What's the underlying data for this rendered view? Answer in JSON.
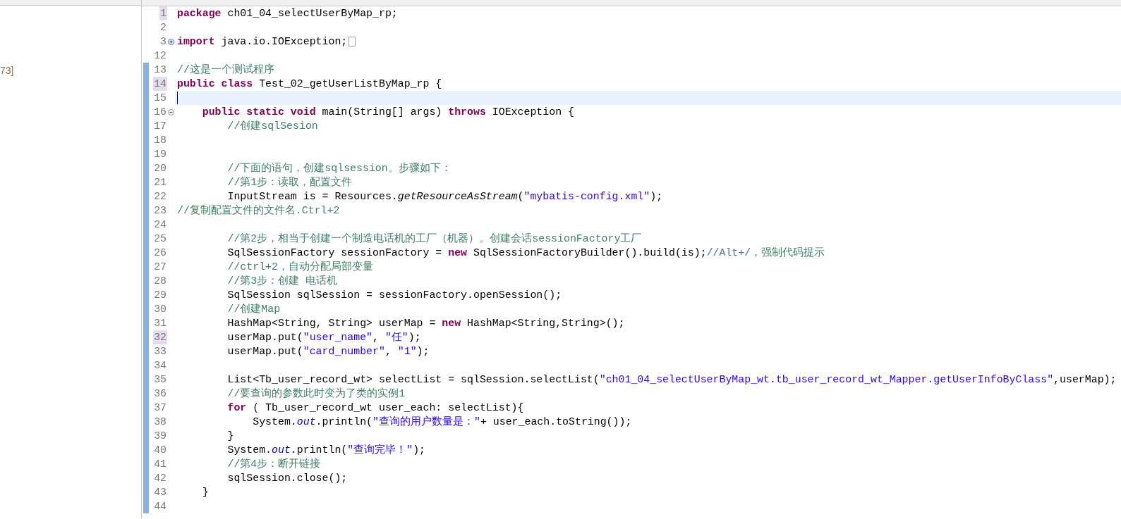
{
  "left_panel": {
    "text": "73]"
  },
  "editor": {
    "lines": [
      {
        "number": "1",
        "marked": true,
        "current": false,
        "changed": false,
        "tokens": [
          {
            "kind": "keyword",
            "text": "package"
          },
          {
            "kind": "plain",
            "text": " ch01_04_selectUserByMap_rp;"
          }
        ]
      },
      {
        "number": "2",
        "marked": false,
        "current": false,
        "changed": false
      },
      {
        "number": "3",
        "marked": false,
        "current": false,
        "changed": false,
        "folding": {
          "collapsed": true
        },
        "tokens": [
          {
            "kind": "keyword",
            "text": "import"
          },
          {
            "kind": "plain",
            "text": " java.io.IOException;"
          }
        ]
      },
      {
        "number": "12",
        "marked": false,
        "current": false,
        "changed": false
      },
      {
        "number": "13",
        "marked": false,
        "current": false,
        "changed": true,
        "tokens": [
          {
            "kind": "comment",
            "text": "//这是一个测试程序"
          }
        ]
      },
      {
        "number": "14",
        "marked": true,
        "current": false,
        "changed": true,
        "tokens": [
          {
            "kind": "keyword",
            "text": "public class"
          },
          {
            "kind": "plain",
            "text": " Test_02_getUserListByMap_rp {"
          }
        ]
      },
      {
        "number": "15",
        "marked": false,
        "current": true,
        "changed": true
      },
      {
        "number": "16",
        "marked": false,
        "current": false,
        "changed": true,
        "folding": {
          "collapsed": false
        },
        "tokens": [
          {
            "kind": "keyword",
            "text": "    public static void"
          },
          {
            "kind": "plain",
            "text": " main(String[] args) "
          },
          {
            "kind": "keyword",
            "text": "throws"
          },
          {
            "kind": "plain",
            "text": " IOException {"
          }
        ]
      },
      {
        "number": "17",
        "marked": false,
        "current": false,
        "changed": true,
        "tokens": [
          {
            "kind": "comment",
            "text": "        //创建sqlSesion"
          }
        ]
      },
      {
        "number": "18",
        "marked": false,
        "current": false,
        "changed": true
      },
      {
        "number": "19",
        "marked": false,
        "current": false,
        "changed": true
      },
      {
        "number": "20",
        "marked": false,
        "current": false,
        "changed": true,
        "tokens": [
          {
            "kind": "comment",
            "text": "        //下面的语句，创建sqlsession。步骤如下："
          }
        ]
      },
      {
        "number": "21",
        "marked": false,
        "current": false,
        "changed": true,
        "tokens": [
          {
            "kind": "comment",
            "text": "        //第1步：读取，配置文件"
          }
        ]
      },
      {
        "number": "22",
        "marked": false,
        "current": false,
        "changed": true,
        "tokens": [
          {
            "kind": "plain",
            "text": "        InputStream is = Resources."
          },
          {
            "kind": "static_method",
            "text": "getResourceAsStream"
          },
          {
            "kind": "plain",
            "text": "("
          },
          {
            "kind": "string",
            "text": "\"mybatis-config.xml\""
          },
          {
            "kind": "plain",
            "text": ");"
          }
        ]
      },
      {
        "number": "23",
        "marked": false,
        "current": false,
        "changed": true,
        "tokens": [
          {
            "kind": "comment",
            "text": "//复制配置文件的文件名.Ctrl+2"
          }
        ]
      },
      {
        "number": "24",
        "marked": false,
        "current": false,
        "changed": true
      },
      {
        "number": "25",
        "marked": false,
        "current": false,
        "changed": true,
        "tokens": [
          {
            "kind": "comment",
            "text": "        //第2步，相当于创建一个制造电话机的工厂（机器）。创建会话sessionFactory工厂"
          }
        ]
      },
      {
        "number": "26",
        "marked": false,
        "current": false,
        "changed": true,
        "tokens": [
          {
            "kind": "plain",
            "text": "        SqlSessionFactory sessionFactory = "
          },
          {
            "kind": "keyword",
            "text": "new"
          },
          {
            "kind": "plain",
            "text": " SqlSessionFactoryBuilder().build(is);"
          },
          {
            "kind": "comment",
            "text": "//Alt+/，强制代码提示"
          }
        ]
      },
      {
        "number": "27",
        "marked": false,
        "current": false,
        "changed": true,
        "tokens": [
          {
            "kind": "comment",
            "text": "        //ctrl+2，自动分配局部变量"
          }
        ]
      },
      {
        "number": "28",
        "marked": false,
        "current": false,
        "changed": true,
        "tokens": [
          {
            "kind": "comment",
            "text": "        //第3步：创建 电话机"
          }
        ]
      },
      {
        "number": "29",
        "marked": false,
        "current": false,
        "changed": true,
        "tokens": [
          {
            "kind": "plain",
            "text": "        SqlSession sqlSession = sessionFactory.openSession();"
          }
        ]
      },
      {
        "number": "30",
        "marked": false,
        "current": false,
        "changed": true,
        "tokens": [
          {
            "kind": "comment",
            "text": "        //创建Map"
          }
        ]
      },
      {
        "number": "31",
        "marked": false,
        "current": false,
        "changed": true,
        "tokens": [
          {
            "kind": "plain",
            "text": "        HashMap<String, String> userMap = "
          },
          {
            "kind": "keyword",
            "text": "new"
          },
          {
            "kind": "plain",
            "text": " HashMap<String,String>();"
          }
        ]
      },
      {
        "number": "32",
        "marked": true,
        "current": false,
        "changed": true,
        "tokens": [
          {
            "kind": "plain",
            "text": "        userMap.put("
          },
          {
            "kind": "string",
            "text": "\"user_name\""
          },
          {
            "kind": "plain",
            "text": ", "
          },
          {
            "kind": "string",
            "text": "\"任\""
          },
          {
            "kind": "plain",
            "text": ");"
          }
        ]
      },
      {
        "number": "33",
        "marked": false,
        "current": false,
        "changed": true,
        "tokens": [
          {
            "kind": "plain",
            "text": "        userMap.put("
          },
          {
            "kind": "string",
            "text": "\"card_number\""
          },
          {
            "kind": "plain",
            "text": ", "
          },
          {
            "kind": "string",
            "text": "\"1\""
          },
          {
            "kind": "plain",
            "text": ");"
          }
        ]
      },
      {
        "number": "34",
        "marked": false,
        "current": false,
        "changed": true
      },
      {
        "number": "35",
        "marked": false,
        "current": false,
        "changed": true,
        "tokens": [
          {
            "kind": "plain",
            "text": "        List<Tb_user_record_wt> selectList = sqlSession.selectList("
          },
          {
            "kind": "string",
            "text": "\"ch01_04_selectUserByMap_wt.tb_user_record_wt_Mapper.getUserInfoByClass\""
          },
          {
            "kind": "plain",
            "text": ",userMap);"
          }
        ]
      },
      {
        "number": "36",
        "marked": false,
        "current": false,
        "changed": true,
        "tokens": [
          {
            "kind": "comment",
            "text": "        //要查询的参数此时变为了类的实例1"
          }
        ]
      },
      {
        "number": "37",
        "marked": false,
        "current": false,
        "changed": true,
        "tokens": [
          {
            "kind": "keyword",
            "text": "        for"
          },
          {
            "kind": "plain",
            "text": " ( Tb_user_record_wt user_each: selectList){"
          }
        ]
      },
      {
        "number": "38",
        "marked": false,
        "current": false,
        "changed": true,
        "tokens": [
          {
            "kind": "plain",
            "text": "            System."
          },
          {
            "kind": "static_field",
            "text": "out"
          },
          {
            "kind": "plain",
            "text": ".println("
          },
          {
            "kind": "string",
            "text": "\"查询的用户数量是：\""
          },
          {
            "kind": "plain",
            "text": "+ user_each.toString());"
          }
        ]
      },
      {
        "number": "39",
        "marked": false,
        "current": false,
        "changed": true,
        "tokens": [
          {
            "kind": "plain",
            "text": "        }"
          }
        ]
      },
      {
        "number": "40",
        "marked": false,
        "current": false,
        "changed": true,
        "tokens": [
          {
            "kind": "plain",
            "text": "        System."
          },
          {
            "kind": "static_field",
            "text": "out"
          },
          {
            "kind": "plain",
            "text": ".println("
          },
          {
            "kind": "string",
            "text": "\"查询完毕！\""
          },
          {
            "kind": "plain",
            "text": ");"
          }
        ]
      },
      {
        "number": "41",
        "marked": false,
        "current": false,
        "changed": true,
        "tokens": [
          {
            "kind": "comment",
            "text": "        //第4步：断开链接"
          }
        ]
      },
      {
        "number": "42",
        "marked": false,
        "current": false,
        "changed": true,
        "tokens": [
          {
            "kind": "plain",
            "text": "        sqlSession.close();"
          }
        ]
      },
      {
        "number": "43",
        "marked": false,
        "current": false,
        "changed": true,
        "tokens": [
          {
            "kind": "plain",
            "text": "    }"
          }
        ]
      },
      {
        "number": "44",
        "marked": false,
        "current": false,
        "changed": true
      }
    ]
  }
}
